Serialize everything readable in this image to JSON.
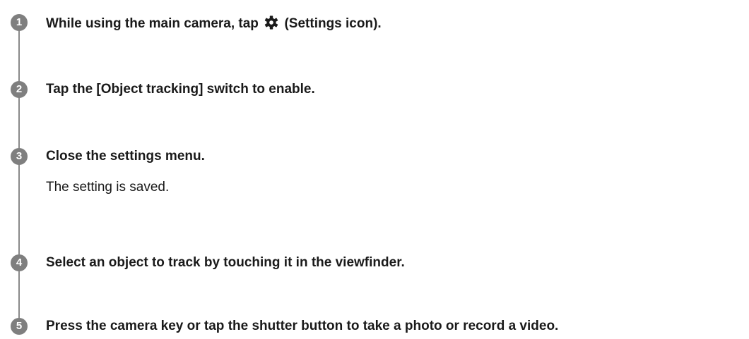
{
  "steps": [
    {
      "number": "1",
      "text_before": "While using the main camera, tap",
      "icon": "gear-icon",
      "text_after": "(Settings icon)."
    },
    {
      "number": "2",
      "text": "Tap the [Object tracking] switch to enable."
    },
    {
      "number": "3",
      "text": "Close the settings menu.",
      "description": "The setting is saved."
    },
    {
      "number": "4",
      "text": "Select an object to track by touching it in the viewfinder."
    },
    {
      "number": "5",
      "text": "Press the camera key or tap the shutter button to take a photo or record a video."
    }
  ],
  "colors": {
    "step_badge": "#7f7f7f",
    "rail": "#8a8a8a",
    "text": "#1a1a1a"
  }
}
